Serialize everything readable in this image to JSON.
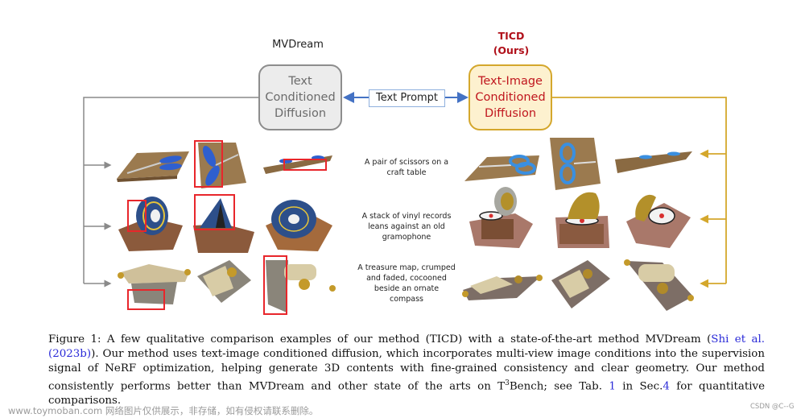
{
  "figure": {
    "left_method": {
      "name": "MVDream",
      "box_lines": [
        "Text",
        "Conditioned",
        "Diffusion"
      ],
      "color_border": "#8d8d8d",
      "color_fill": "#ececec"
    },
    "right_method": {
      "name_line1": "TICD",
      "name_line2": "(Ours)",
      "box_lines": [
        "Text-Image",
        "Conditioned",
        "Diffusion"
      ],
      "color_border": "#d4a72c",
      "color_fill": "#fdf1cf",
      "color_text": "#c0161e"
    },
    "prompt_box_label": "Text Prompt",
    "prompts": [
      {
        "lines": [
          "A pair of scissors on a",
          "craft table"
        ]
      },
      {
        "lines": [
          "A stack of vinyl records",
          "leans against an old",
          "gramophone"
        ]
      },
      {
        "lines": [
          "A treasure map, crumped",
          "and faded, cocooned",
          "beside an ornate",
          "compass"
        ]
      }
    ],
    "rows": [
      {
        "subject": "scissors",
        "left_views": [
          "scissors-view-1",
          "scissors-view-2",
          "scissors-view-3"
        ],
        "right_views": [
          "scissors-view-1",
          "scissors-view-2",
          "scissors-view-3"
        ]
      },
      {
        "subject": "gramophone",
        "left_views": [
          "gramophone-view-1",
          "gramophone-view-2",
          "gramophone-view-3"
        ],
        "right_views": [
          "gramophone-view-1",
          "gramophone-view-2",
          "gramophone-view-3"
        ]
      },
      {
        "subject": "treasure-map",
        "left_views": [
          "map-view-1",
          "map-view-2",
          "map-view-3"
        ],
        "right_views": [
          "map-view-1",
          "map-view-2",
          "map-view-3"
        ]
      }
    ],
    "artifact_highlight_color": "#e8262b"
  },
  "caption": {
    "prefix": "Figure 1:  A few qualitative comparison examples of our method (TICD) with a state-of-the-art method MVDream (",
    "cite1": "Shi et al. (2023b)",
    "part2": "). Our method uses text-image conditioned diffusion, which incorporates multi-view image conditions into the supervision signal of NeRF optimization, helping generate 3D contents with fine-grained consistency and clear geometry. Our method consistently performs better than MVDream and other state of the arts on T",
    "sup": "3",
    "part3": "Bench; see Tab. ",
    "ref_tab": "1",
    "part4": " in Sec.",
    "ref_sec": "4",
    "part5": " for quantitative comparisons."
  },
  "watermarks": {
    "left": "www.toymoban.com 网络图片仅供展示，非存储，如有侵权请联系删除。",
    "right": "CSDN @C--G"
  }
}
